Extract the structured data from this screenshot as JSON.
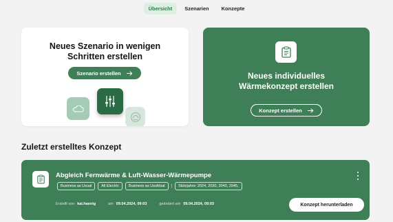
{
  "nav": {
    "tabs": [
      {
        "label": "Übersicht",
        "active": true
      },
      {
        "label": "Szenarien",
        "active": false
      },
      {
        "label": "Konzepte",
        "active": false
      }
    ]
  },
  "scenario_card": {
    "title_line1": "Neues Szenario in wenigen",
    "title_line2": "Schritten erstellen",
    "button_label": "Szenario erstellen",
    "illustration_icons": [
      "cloud-icon",
      "sliders-icon",
      "gauge-icon"
    ]
  },
  "concept_card": {
    "icon": "clipboard-icon",
    "title_line1": "Neues individuelles",
    "title_line2": "Wärmekonzept erstellen",
    "button_label": "Konzept erstellen"
  },
  "recent": {
    "section_title": "Zuletzt erstelltes Konzept",
    "item": {
      "icon": "clipboard-icon",
      "title": "Abgleich Fernwärme & Luft-Wasser-Wärmepumpe",
      "tags": [
        "Business as Usual",
        "All Electric",
        "Business as Usufdsal"
      ],
      "support_years": "Stützjahre: 2024, 2030, 2040, 2045,",
      "created_by_label": "Erstellt von",
      "created_by": "kai.haenig",
      "created_at_label": "am",
      "created_at": "09.04.2024, 09:03",
      "changed_label": "geändert am",
      "changed_at": "09.04.2024, 09:03",
      "download_label": "Konzept herunterladen"
    }
  },
  "colors": {
    "accent": "#3f7f57",
    "background": "#f3f3f3",
    "active_tab_bg": "#dcefe2"
  }
}
